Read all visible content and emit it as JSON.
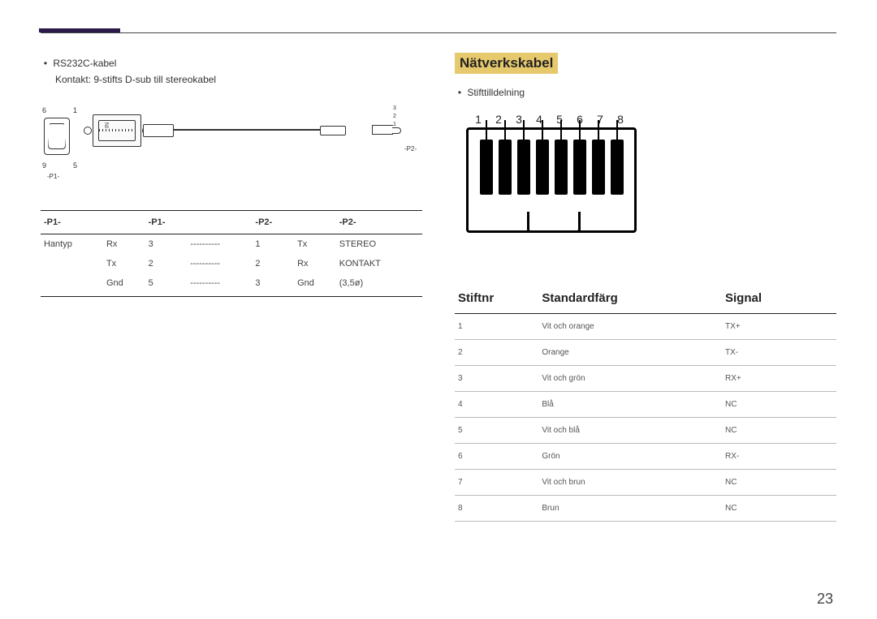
{
  "left": {
    "bullet1": "RS232C-kabel",
    "bullet1_sub": "Kontakt: 9-stifts D-sub till stereokabel",
    "diagram": {
      "pin6": "6",
      "pin1": "1",
      "pin9": "9",
      "pin5": "5",
      "p1_small": "-P1-",
      "in": "IN",
      "jack3": "3",
      "jack2": "2",
      "jack1": "1",
      "p2_small": "-P2-"
    },
    "table": {
      "heads": [
        "-P1-",
        "",
        "-P1-",
        "",
        "-P2-",
        "",
        "-P2-"
      ],
      "rows": [
        [
          "Hantyp",
          "Rx",
          "3",
          "----------",
          "1",
          "Tx",
          "STEREO"
        ],
        [
          "",
          "Tx",
          "2",
          "----------",
          "2",
          "Rx",
          "KONTAKT"
        ],
        [
          "",
          "Gnd",
          "5",
          "----------",
          "3",
          "Gnd",
          "(3,5ø)"
        ]
      ]
    }
  },
  "right": {
    "title": "Nätverkskabel",
    "bullet1": "Stifttilldelning",
    "rj_nums": [
      "1",
      "2",
      "3",
      "4",
      "5",
      "6",
      "7",
      "8"
    ],
    "table": {
      "heads": [
        "Stiftnr",
        "Standardfärg",
        "Signal"
      ],
      "rows": [
        [
          "1",
          "Vit och orange",
          "TX+"
        ],
        [
          "2",
          "Orange",
          "TX-"
        ],
        [
          "3",
          "Vit och grön",
          "RX+"
        ],
        [
          "4",
          "Blå",
          "NC"
        ],
        [
          "5",
          "Vit och blå",
          "NC"
        ],
        [
          "6",
          "Grön",
          "RX-"
        ],
        [
          "7",
          "Vit och brun",
          "NC"
        ],
        [
          "8",
          "Brun",
          "NC"
        ]
      ]
    }
  },
  "page_number": "23"
}
